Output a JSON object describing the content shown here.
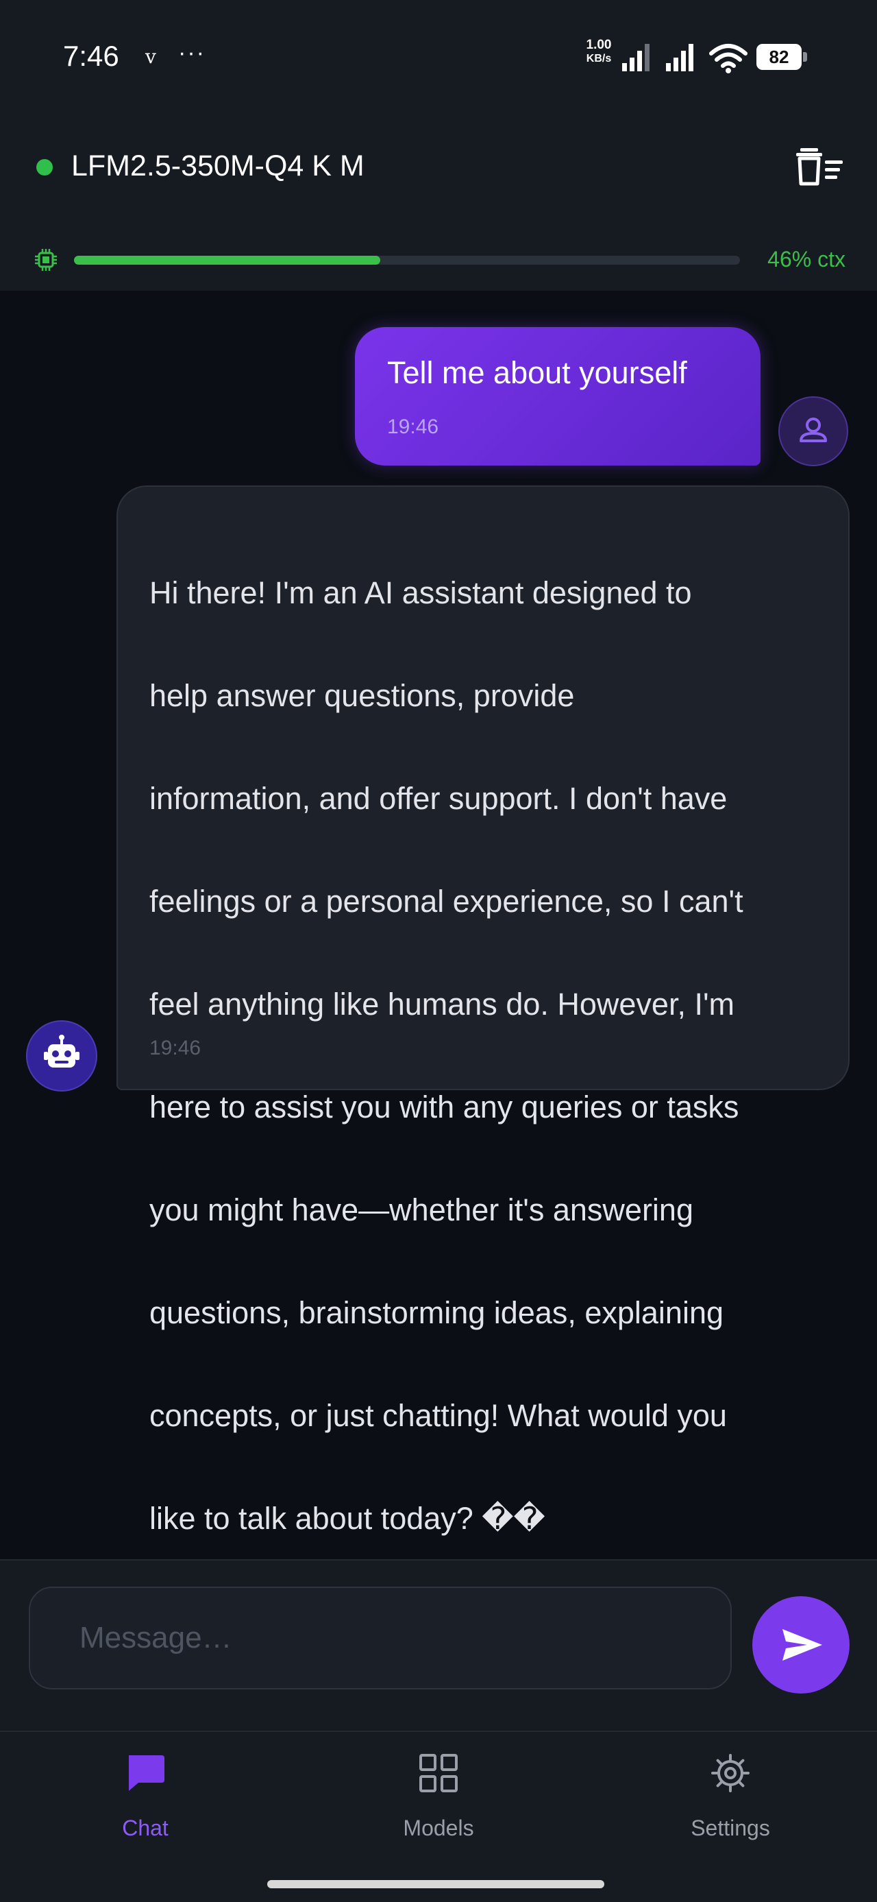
{
  "status_bar": {
    "time": "7:46",
    "carrier_mark": "v",
    "more": "···",
    "net_speed_value": "1.00",
    "net_speed_unit": "KB/s",
    "battery": "82",
    "icons": [
      "signal-icon",
      "signal-icon",
      "wifi-icon",
      "battery-icon"
    ]
  },
  "header": {
    "model_name": "LFM2.5-350M-Q4 K M",
    "status_color": "#2fbf4a",
    "context_fraction": 0.46,
    "context_label": "46% ctx"
  },
  "messages": [
    {
      "role": "user",
      "text": "Tell me about yourself",
      "time": "19:46"
    },
    {
      "role": "assistant",
      "lines": [
        "Hi there! I'm an AI assistant designed to",
        "help answer questions, provide",
        "information, and offer support. I don't have",
        "feelings or a personal experience, so I can't",
        "feel anything like humans do. However, I'm",
        "here to assist you with any queries or tasks",
        "you might have—whether it's answering",
        "questions, brainstorming ideas, explaining",
        "concepts, or just chatting! What would you",
        "like to talk about today? ��"
      ],
      "time": "19:46"
    }
  ],
  "composer": {
    "placeholder": "Message…"
  },
  "nav": {
    "items": [
      {
        "label": "Chat",
        "icon": "chat-icon",
        "active": true
      },
      {
        "label": "Models",
        "icon": "grid-icon",
        "active": false
      },
      {
        "label": "Settings",
        "icon": "gear-icon",
        "active": false
      }
    ]
  },
  "colors": {
    "accent": "#7c3aed",
    "success": "#3bbf4b",
    "background": "#0b0e14",
    "surface": "#161a21"
  }
}
